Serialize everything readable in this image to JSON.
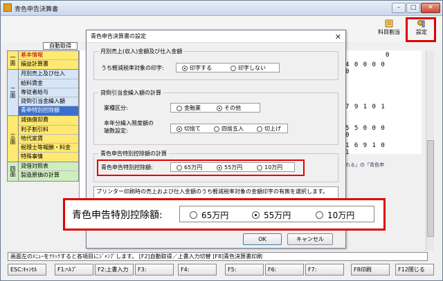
{
  "window": {
    "title": "青色申告決算書",
    "min": "–",
    "max": "□",
    "close": "✕"
  },
  "toolbar": {
    "kamoku": "科目割当",
    "settei": "設定"
  },
  "auto_fetch": "自動取得",
  "nav": {
    "groups": [
      {
        "label": "一面",
        "items": [
          "基本情報",
          "損益計算書"
        ]
      },
      {
        "label": "二面",
        "items": [
          "月別売上及び仕入",
          "給料賃金",
          "専従者給与",
          "貸倒引当金繰入額",
          "青申特別控除額"
        ]
      },
      {
        "label": "三面",
        "items": [
          "減価償却費",
          "利子割引料",
          "地代家賃",
          "税理士等報酬・料金",
          "特殊事情"
        ]
      },
      {
        "label": "四面",
        "items": [
          "貸借対照表",
          "製造原価の計算"
        ]
      }
    ]
  },
  "right_values": [
    "0",
    "4 0 0 0 0 0",
    "7 9 1 0 1",
    "5 5 0 0 0 0",
    "1 6 9 1 0 1"
  ],
  "right_note": "れる」の「青色申",
  "dialog": {
    "title": "青色申告決算書の設定",
    "close": "✕",
    "sec1": {
      "heading": "月別売上(収入)金額及び仕入金額",
      "label": "うち軽減税率対象の印字:",
      "options": [
        "印字する",
        "印字しない"
      ],
      "selected": 0
    },
    "sec2": {
      "heading": "貸倒引当金繰入額の計算",
      "label1": "業種区分:",
      "options1": [
        "金融業",
        "その他"
      ],
      "selected1": 1,
      "label2a": "本年分繰入限度額の",
      "label2b": "端数設定:",
      "options2": [
        "切捨て",
        "四捨五入",
        "切上げ"
      ],
      "selected2": 0
    },
    "sec3": {
      "heading": "青色申告特別控除額の計算",
      "label": "青色申告特別控除額:",
      "options": [
        "65万円",
        "55万円",
        "10万円"
      ],
      "selected": 1
    },
    "description": "プリンター印刷時の売上および仕入金額のうち軽減税率対象の金額印字の有無を選択します。",
    "ok": "OK",
    "cancel": "キャンセル"
  },
  "zoom": {
    "label": "青色申告特別控除額:",
    "options": [
      "65万円",
      "55万円",
      "10万円"
    ],
    "selected": 1
  },
  "status": "画面左のﾒﾆｭｰをｸﾘｯｸすると各項目にｼﾞｬﾝﾌﾟします。 [F2]自動取得／上書入力切替 [F8]青色決算書印刷",
  "fkeys": [
    "ESC:ｷｬﾝｾﾙ",
    "F1:ﾍﾙﾌﾟ",
    "F2:上書入力",
    "F3:",
    "F4:",
    "F5:",
    "F6:",
    "F7:",
    "F8印刷",
    "F12閉じる"
  ],
  "colors": {
    "highlight_red": "#e00000",
    "nav_yellow": "#ffe970",
    "nav_blue": "#d6e6f8",
    "nav_green": "#cfeec0",
    "nav_selected": "#3a6fd0"
  }
}
